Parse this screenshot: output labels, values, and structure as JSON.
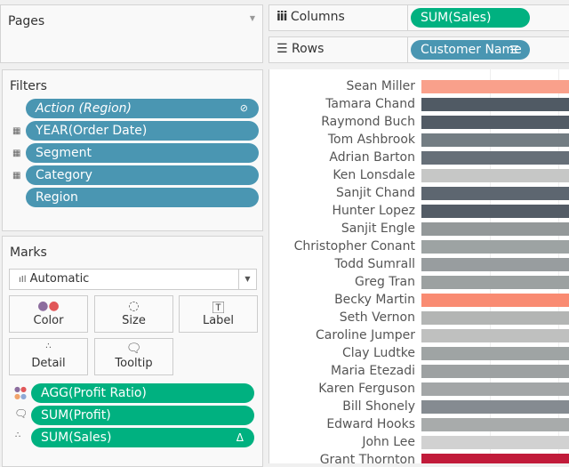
{
  "pages": {
    "title": "Pages"
  },
  "columns": {
    "label": "Columns",
    "icon": "columns-icon",
    "pill": "SUM(Sales)"
  },
  "rows": {
    "label": "Rows",
    "icon": "rows-icon",
    "pill": "Customer Name"
  },
  "filters": {
    "title": "Filters",
    "items": [
      {
        "label": "Action (Region)",
        "italic": true,
        "icon": "link-icon"
      },
      {
        "label": "YEAR(Order Date)",
        "icon": "context-filter-icon"
      },
      {
        "label": "Segment",
        "icon": "context-filter-icon"
      },
      {
        "label": "Category",
        "icon": "context-filter-icon"
      },
      {
        "label": "Region"
      }
    ]
  },
  "marks": {
    "title": "Marks",
    "type": "Automatic",
    "buttons": [
      "Color",
      "Size",
      "Label",
      "Detail",
      "Tooltip"
    ],
    "fields": [
      {
        "label": "AGG(Profit Ratio)",
        "icon": "color-icon"
      },
      {
        "label": "SUM(Profit)",
        "icon": "tooltip-icon"
      },
      {
        "label": "SUM(Sales)",
        "icon": "detail-icon",
        "badge": "Δ"
      }
    ]
  },
  "chart_data": {
    "type": "bar",
    "orientation": "horizontal",
    "xlabel": "SUM(Sales)",
    "ylabel": "Customer Name",
    "color_by": "AGG(Profit Ratio)",
    "categories": [
      "Sean Miller",
      "Tamara Chand",
      "Raymond Buch",
      "Tom Ashbrook",
      "Adrian Barton",
      "Ken Lonsdale",
      "Sanjit Chand",
      "Hunter Lopez",
      "Sanjit Engle",
      "Christopher Conant",
      "Todd Sumrall",
      "Greg Tran",
      "Becky Martin",
      "Seth Vernon",
      "Caroline Jumper",
      "Clay Ludtke",
      "Maria Etezadi",
      "Karen Ferguson",
      "Bill Shonely",
      "Edward Hooks",
      "John Lee",
      "Grant Thornton"
    ],
    "colors": [
      "#f9a08b",
      "#505a64",
      "#525b65",
      "#737d83",
      "#666f78",
      "#c6c7c6",
      "#5d6670",
      "#535c66",
      "#939899",
      "#9da3a3",
      "#989d9f",
      "#9ca1a1",
      "#f98b72",
      "#b3b5b4",
      "#bfc0bf",
      "#9fa4a4",
      "#9da1a2",
      "#a3a6a7",
      "#858b91",
      "#a8abab",
      "#d1d1d1",
      "#c11b3a"
    ],
    "sort": "descending"
  }
}
